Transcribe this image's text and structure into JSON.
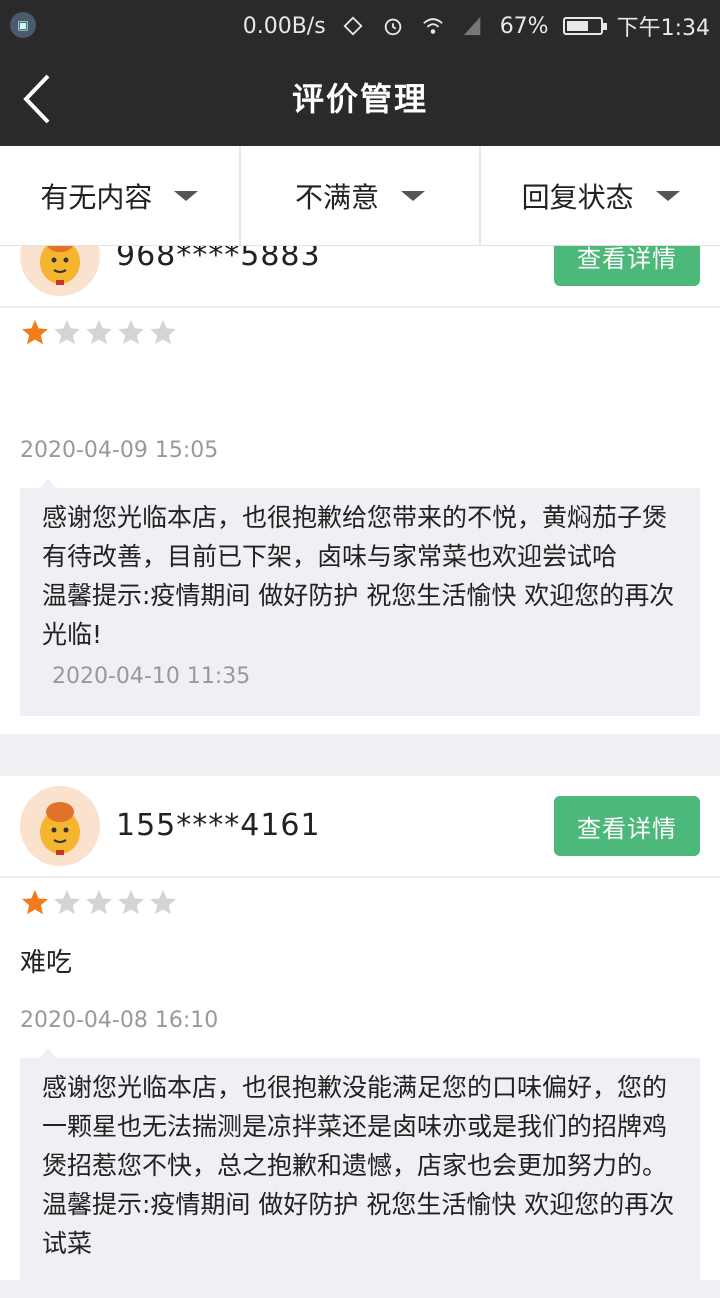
{
  "status_bar": {
    "net_speed": "0.00B/s",
    "battery": "67%",
    "battery_level": 0.67,
    "time": "下午1:34"
  },
  "app_bar": {
    "title": "评价管理"
  },
  "filters": [
    {
      "label": "有无内容"
    },
    {
      "label": "不满意"
    },
    {
      "label": "回复状态"
    }
  ],
  "reviews": [
    {
      "phone": "968****5883",
      "detail_label": "查看详情",
      "rating": 1,
      "max_rating": 5,
      "comment": "",
      "date": "2020-04-09  15:05",
      "reply": "感谢您光临本店，也很抱歉给您带来的不悦，黄焖茄子煲有待改善，目前已下架，卤味与家常菜也欢迎尝试哈\n温馨提示:疫情期间 做好防护 祝您生活愉快 欢迎您的再次光临!",
      "reply_date": "2020-04-10  11:35"
    },
    {
      "phone": "155****4161",
      "detail_label": "查看详情",
      "rating": 1,
      "max_rating": 5,
      "comment": "难吃",
      "date": "2020-04-08  16:10",
      "reply": "感谢您光临本店，也很抱歉没能满足您的口味偏好，您的一颗星也无法揣测是凉拌菜还是卤味亦或是我们的招牌鸡煲招惹您不快，总之抱歉和遗憾，店家也会更加努力的。\n温馨提示:疫情期间 做好防护 祝您生活愉快 欢迎您的再次试菜",
      "reply_date": ""
    }
  ],
  "colors": {
    "bar_bg": "#2a2a2a",
    "accent_green": "#4cb97a",
    "star_active": "#f07d1a",
    "star_inactive": "#d4d4d4"
  }
}
